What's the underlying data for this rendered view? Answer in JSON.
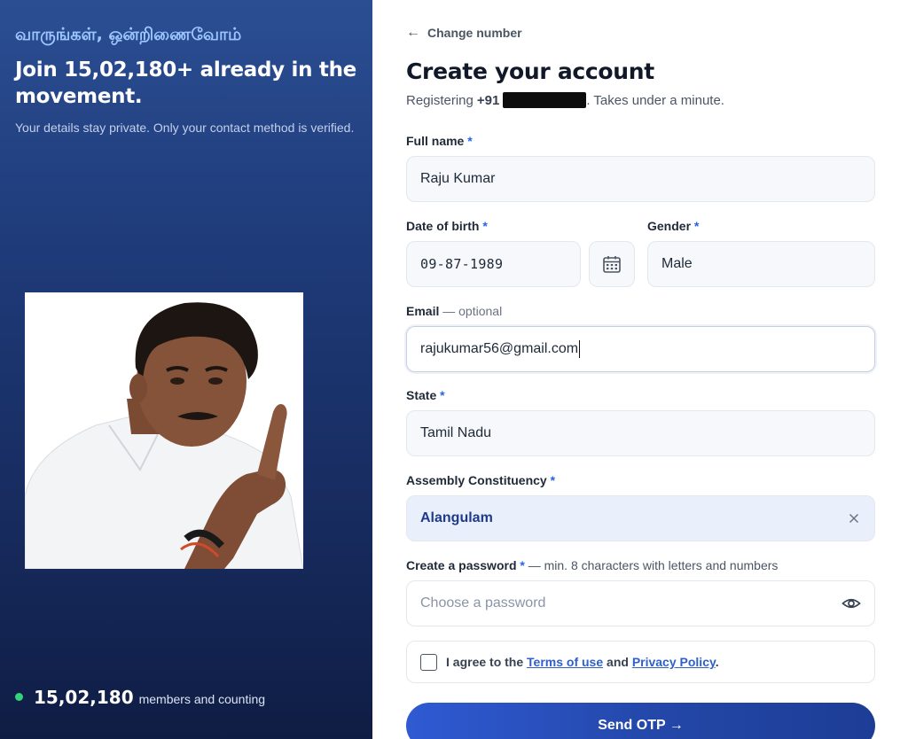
{
  "left": {
    "tamil_greeting": "வாருங்கள், ஒன்றிணைவோம்",
    "headline": "Join 15,02,180+ already in the movement.",
    "privacy_note": "Your details stay private. Only your contact method is verified.",
    "members_count": "15,02,180",
    "members_suffix": "members and counting"
  },
  "form": {
    "back_label": "Change number",
    "title": "Create your account",
    "registering_prefix": "Registering",
    "country_code": "+91",
    "registering_suffix": ". Takes under a minute.",
    "full_name": {
      "label": "Full name",
      "required": "*",
      "value": "Raju Kumar"
    },
    "dob": {
      "label": "Date of birth",
      "required": "*",
      "value": "09-87-1989"
    },
    "gender": {
      "label": "Gender",
      "required": "*",
      "value": "Male"
    },
    "email": {
      "label": "Email",
      "optional": "— optional",
      "value": "rajukumar56@gmail.com"
    },
    "state": {
      "label": "State",
      "required": "*",
      "value": "Tamil Nadu"
    },
    "constituency": {
      "label": "Assembly Constituency",
      "required": "*",
      "value": "Alangulam"
    },
    "password": {
      "label": "Create a password",
      "required": "*",
      "hint": "— min. 8 characters with letters and numbers",
      "placeholder": "Choose a password"
    },
    "terms": {
      "prefix": "I agree to the",
      "terms_link": "Terms of use",
      "and": "and",
      "privacy_link": "Privacy Policy",
      "suffix": "."
    },
    "submit_label": "Send OTP →"
  },
  "colors": {
    "accent": "#2563eb",
    "left_panel_top": "#2b4e93",
    "left_panel_bottom": "#0f1d44",
    "status_dot": "#34d37a"
  },
  "icons": [
    "back-arrow-icon",
    "calendar-icon",
    "clear-x-icon",
    "eye-icon",
    "status-dot-icon"
  ]
}
